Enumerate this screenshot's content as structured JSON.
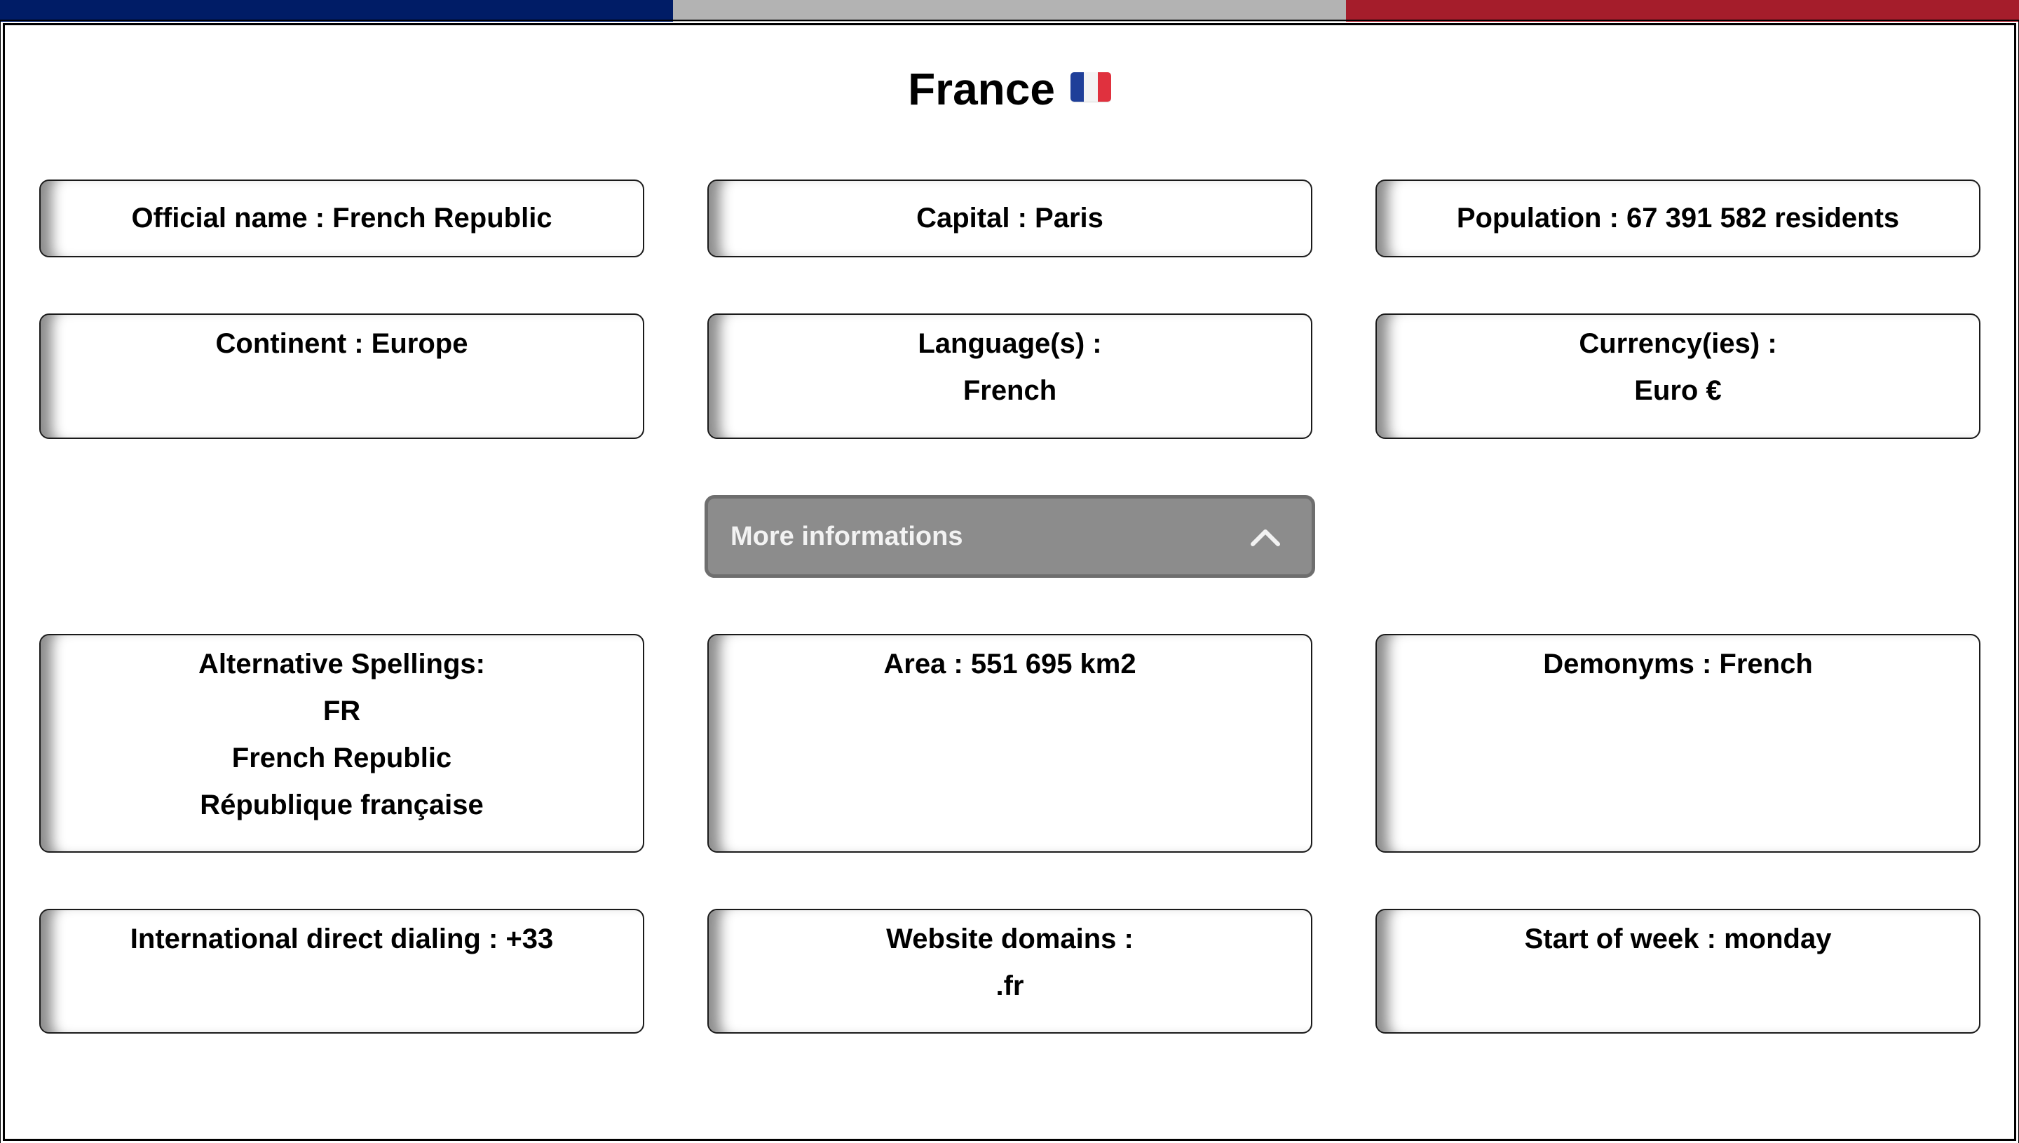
{
  "colors": {
    "flag_blue": "#001c66",
    "flag_white": "#b3b3b3",
    "flag_red": "#a51d2b",
    "card_border": "#1a1a1a",
    "accordion_bg": "#8c8c8c",
    "accordion_border": "#6e6e6e",
    "accordion_text": "#f2f2f2"
  },
  "header": {
    "title": "France",
    "flag_icon": "flag-france-icon"
  },
  "cards": {
    "official_name": "Official name : French Republic",
    "capital": "Capital : Paris",
    "population": "Population : 67 391 582 residents",
    "continent": "Continent : Europe",
    "languages": {
      "label": "Language(s) :",
      "values": [
        "French"
      ]
    },
    "currencies": {
      "label": "Currency(ies) :",
      "values": [
        "Euro €"
      ]
    }
  },
  "accordion": {
    "label": "More informations",
    "icon": "chevron-up-icon",
    "expanded": true
  },
  "more": {
    "alt_spellings": {
      "label": "Alternative Spellings:",
      "values": [
        "FR",
        "French Republic",
        "République française"
      ]
    },
    "area": "Area : 551 695 km2",
    "demonyms": "Demonyms : French",
    "dialing": "International direct dialing : +33",
    "domains": {
      "label": "Website domains :",
      "values": [
        ".fr"
      ]
    },
    "start_of_week": "Start of week : monday"
  }
}
